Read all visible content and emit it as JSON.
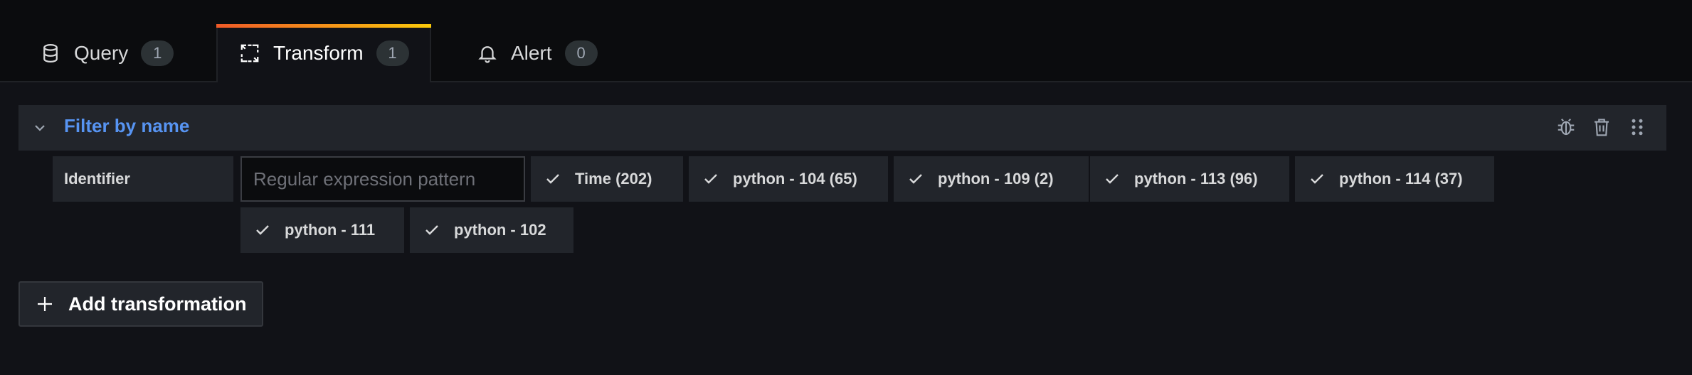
{
  "tabs": {
    "query": {
      "label": "Query",
      "count": "1",
      "icon": "database-icon"
    },
    "transform": {
      "label": "Transform",
      "count": "1",
      "icon": "transform-icon",
      "active": true
    },
    "alert": {
      "label": "Alert",
      "count": "0",
      "icon": "bell-icon"
    }
  },
  "colors": {
    "accent_gradient": [
      "#f05a28",
      "#fbca0a"
    ],
    "link": "#5794f2",
    "background": "#111217"
  },
  "transformation": {
    "title": "Filter by name",
    "actions": [
      "bug-icon",
      "trash-icon",
      "drag-handle-icon"
    ],
    "identifier_label": "Identifier",
    "regex_placeholder": "Regular expression pattern",
    "regex_value": "",
    "fields": [
      {
        "label": "Time (202)",
        "checked": true
      },
      {
        "label": "python - 104 (65)",
        "checked": true
      },
      {
        "label": "python - 109 (2)",
        "checked": true
      },
      {
        "label": "python - 113 (96)",
        "checked": true
      },
      {
        "label": "python - 114 (37)",
        "checked": true
      },
      {
        "label": "python - 111",
        "checked": true
      },
      {
        "label": "python - 102",
        "checked": true
      }
    ]
  },
  "add_button": {
    "label": "Add transformation"
  }
}
